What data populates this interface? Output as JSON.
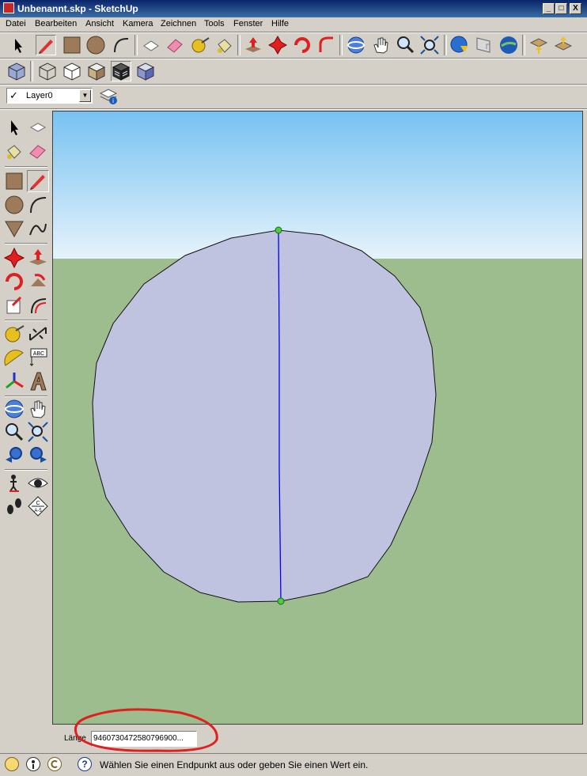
{
  "window": {
    "title": "Unbenannt.skp - SketchUp",
    "min_label": "_",
    "max_label": "□",
    "close_label": "X"
  },
  "menu": {
    "items": [
      "Datei",
      "Bearbeiten",
      "Ansicht",
      "Kamera",
      "Zeichnen",
      "Tools",
      "Fenster",
      "Hilfe"
    ]
  },
  "toolbar_main": {
    "icons": [
      "select-icon",
      "pencil-icon",
      "rectangle-icon",
      "circle-icon",
      "arc-icon",
      "make-component-icon",
      "eraser-icon",
      "tape-measure-icon",
      "paint-bucket-icon",
      "push-pull-icon",
      "move-icon",
      "rotate-icon",
      "follow-me-icon",
      "orbit-icon",
      "pan-icon",
      "zoom-icon",
      "zoom-extents-icon",
      "get-models-icon",
      "share-model-icon",
      "google-earth-icon",
      "import-component-icon",
      "share-component-icon"
    ]
  },
  "toolbar_views": {
    "icons": [
      "xray-icon",
      "wireframe-icon",
      "hidden-line-icon",
      "shaded-icon",
      "shaded-texture-icon",
      "monochrome-icon"
    ]
  },
  "layers": {
    "current": "Layer0",
    "check": "✓",
    "dropdown": "▼"
  },
  "left_tools": {
    "icons": [
      "select-icon",
      "make-component-icon",
      "paint-bucket-icon",
      "eraser-icon",
      "rectangle-icon",
      "pencil-icon",
      "circle-icon",
      "arc-icon",
      "polygon-icon",
      "freehand-icon",
      "move-icon",
      "push-pull-icon",
      "rotate-icon",
      "follow-me-icon",
      "scale-icon",
      "offset-icon",
      "tape-measure-icon",
      "dimension-icon",
      "protractor-icon",
      "text-icon",
      "axes-icon",
      "3d-text-icon",
      "orbit-icon",
      "pan-icon",
      "zoom-icon",
      "zoom-window-icon",
      "previous-view-icon",
      "next-view-icon",
      "position-camera-icon",
      "look-around-icon",
      "walk-icon",
      "section-plane-icon"
    ],
    "text_tool_label": "ABC",
    "section_label": "C\nA-5"
  },
  "vcb": {
    "label": "Länge",
    "value": "9460730472580796900..."
  },
  "status": {
    "message": "Wählen Sie einen Endpunkt aus oder geben Sie einen Wert ein.",
    "help_icon_label": "?"
  },
  "colors": {
    "sky_top": "#77c2f2",
    "sky_bottom": "#e6f3fb",
    "ground": "#9dbd8f",
    "face": "#c0c3df",
    "edge_selected": "#0000ff",
    "endpoint": "#4ccc3c",
    "annotation": "#e02020"
  }
}
